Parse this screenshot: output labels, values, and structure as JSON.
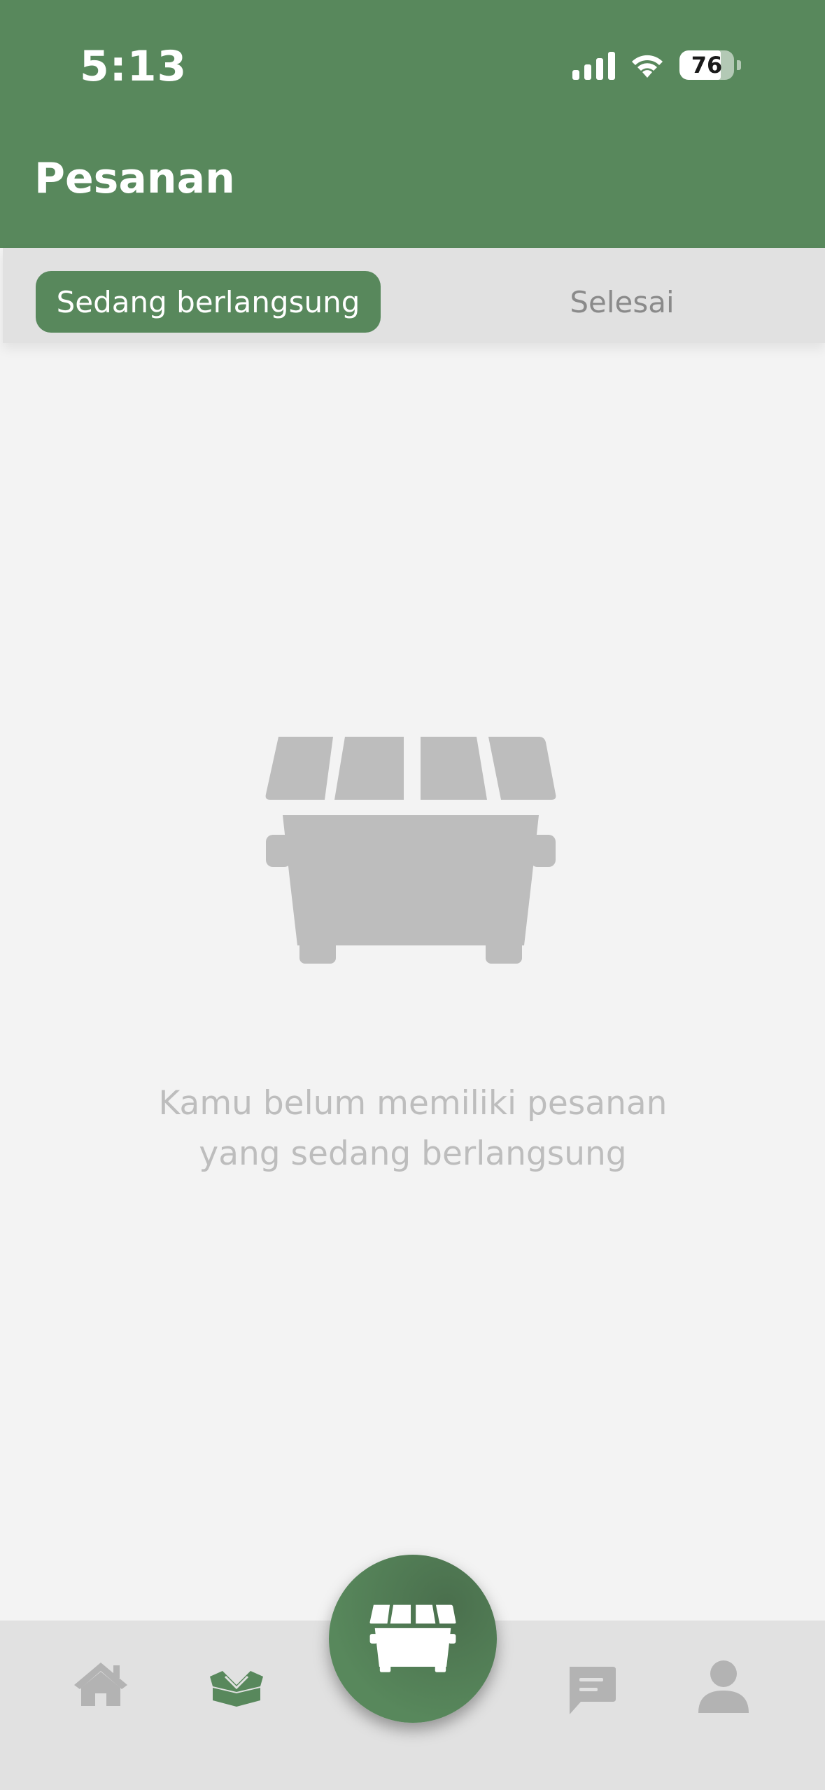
{
  "status_bar": {
    "time": "5:13",
    "battery_level": "76",
    "signal_icon": "cellular-signal-icon",
    "wifi_icon": "wifi-icon"
  },
  "header": {
    "title": "Pesanan",
    "background_color": "#58885c"
  },
  "tabs": [
    {
      "label": "Sedang berlangsung",
      "active": true
    },
    {
      "label": "Selesai",
      "active": false
    }
  ],
  "empty_state": {
    "icon": "dumpster-icon",
    "message_line1": "Kamu belum memiliki pesanan",
    "message_line2": "yang sedang berlangsung"
  },
  "bottom_nav": {
    "items": [
      {
        "icon": "home-icon",
        "active": false
      },
      {
        "icon": "open-box-icon",
        "active": true
      },
      {
        "icon": "dumpster-icon",
        "center_action": true
      },
      {
        "icon": "chat-icon",
        "active": false
      },
      {
        "icon": "profile-icon",
        "active": false
      }
    ]
  },
  "colors": {
    "accent": "#58885c",
    "inactive_icon": "#b3b3b3",
    "muted_text": "#bdbdbd"
  }
}
